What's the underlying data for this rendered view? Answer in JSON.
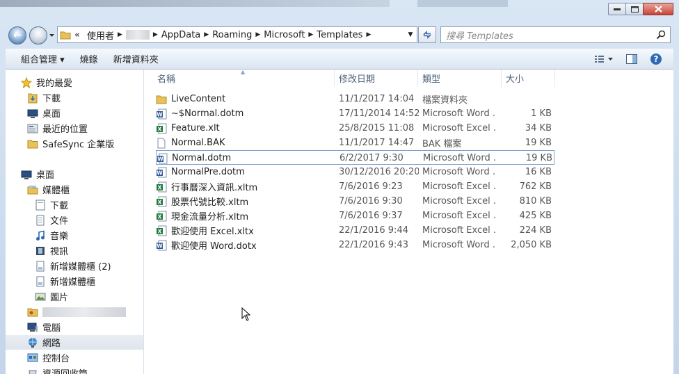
{
  "address": {
    "overflow": "«",
    "segments": [
      "使用者",
      "AppData",
      "Roaming",
      "Microsoft",
      "Templates"
    ],
    "blurred_segment_index": 1
  },
  "search": {
    "placeholder": "搜尋 Templates"
  },
  "toolbar": {
    "organize": "組合管理 ▾",
    "burn": "燒錄",
    "new_folder": "新增資料夾"
  },
  "nav": {
    "favorites": "我的最愛",
    "downloads": "下載",
    "desktop": "桌面",
    "recent": "最近的位置",
    "safesync": "SafeSync 企業版",
    "desktop2": "桌面",
    "libraries": "媒體櫃",
    "lib_downloads": "下載",
    "lib_documents": "文件",
    "lib_music": "音樂",
    "lib_videos": "視訊",
    "lib_new2": "新增媒體櫃 (2)",
    "lib_new": "新增媒體櫃",
    "lib_pictures": "圖片",
    "computer": "電腦",
    "network": "網路",
    "control_panel": "控制台",
    "recycle": "資源回收筒"
  },
  "columns": {
    "name": "名稱",
    "modified": "修改日期",
    "type": "類型",
    "size": "大小"
  },
  "files": [
    {
      "name": "LiveContent",
      "date": "11/1/2017 14:04",
      "type": "檔案資料夾",
      "size": "",
      "icon": "folder-icon"
    },
    {
      "name": "~$Normal.dotm",
      "date": "17/11/2014 14:52",
      "type": "Microsoft Word ...",
      "size": "1 KB",
      "icon": "word-icon"
    },
    {
      "name": "Feature.xlt",
      "date": "25/8/2015 11:08",
      "type": "Microsoft Excel ...",
      "size": "34 KB",
      "icon": "excel-icon"
    },
    {
      "name": "Normal.BAK",
      "date": "11/1/2017 14:47",
      "type": "BAK 檔案",
      "size": "19 KB",
      "icon": "blank-file-icon"
    },
    {
      "name": "Normal.dotm",
      "date": "6/2/2017 9:30",
      "type": "Microsoft Word ...",
      "size": "19 KB",
      "icon": "word-icon"
    },
    {
      "name": "NormalPre.dotm",
      "date": "30/12/2016 20:20",
      "type": "Microsoft Word ...",
      "size": "16 KB",
      "icon": "word-icon"
    },
    {
      "name": "行事曆深入資訊.xltm",
      "date": "7/6/2016 9:23",
      "type": "Microsoft Excel ...",
      "size": "762 KB",
      "icon": "excel-icon"
    },
    {
      "name": "股票代號比較.xltm",
      "date": "7/6/2016 9:30",
      "type": "Microsoft Excel ...",
      "size": "810 KB",
      "icon": "excel-icon"
    },
    {
      "name": "現金流量分析.xltm",
      "date": "7/6/2016 9:37",
      "type": "Microsoft Excel ...",
      "size": "425 KB",
      "icon": "excel-icon"
    },
    {
      "name": "歡迎使用 Excel.xltx",
      "date": "22/1/2016 9:44",
      "type": "Microsoft Excel ...",
      "size": "224 KB",
      "icon": "excel-icon"
    },
    {
      "name": "歡迎使用 Word.dotx",
      "date": "22/1/2016 9:43",
      "type": "Microsoft Word ...",
      "size": "2,050 KB",
      "icon": "word-icon"
    }
  ],
  "selected_file_index": 4,
  "colors": {
    "selection_border": "#7da2ce",
    "excel": "#1f7a3d",
    "word": "#2b5797",
    "folder": "#e8c15a"
  }
}
